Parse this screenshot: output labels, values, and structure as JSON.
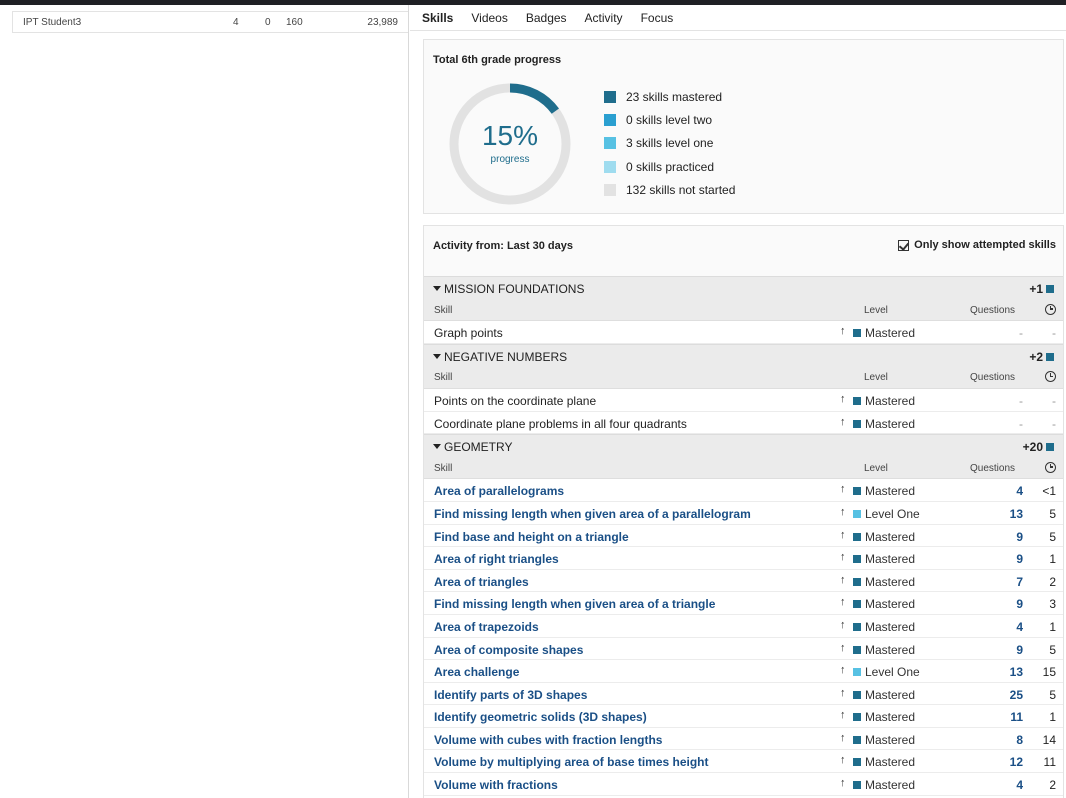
{
  "student": {
    "name": "IPT Student3",
    "col_a": "4",
    "col_b": "0",
    "col_c": "160",
    "col_d": "23,989"
  },
  "tabs": [
    {
      "label": "Skills",
      "active": true
    },
    {
      "label": "Videos",
      "active": false
    },
    {
      "label": "Badges",
      "active": false
    },
    {
      "label": "Activity",
      "active": false
    },
    {
      "label": "Focus",
      "active": false
    }
  ],
  "progress": {
    "title": "Total 6th grade progress",
    "percent_label": "15%",
    "sub_label": "progress",
    "fraction": 0.15,
    "legend": [
      {
        "label": "23 skills mastered",
        "color": "#1f6d8c"
      },
      {
        "label": "0 skills level two",
        "color": "#2b9fd0"
      },
      {
        "label": "3 skills level one",
        "color": "#57c1e3"
      },
      {
        "label": "0 skills practiced",
        "color": "#9fdcef"
      },
      {
        "label": "132 skills not started",
        "color": "#e2e2e2"
      }
    ]
  },
  "activity": {
    "label": "Activity from: Last 30 days",
    "filter_label": "Only show attempted skills"
  },
  "columns": {
    "skill": "Skill",
    "level": "Level",
    "questions": "Questions"
  },
  "colors": {
    "mastered": "#1f6d8c",
    "level_one": "#57c1e3",
    "link": "#1a4f86"
  },
  "sections": [
    {
      "name": "MISSION FOUNDATIONS",
      "count": "+1",
      "skills": [
        {
          "name": "Graph points",
          "level": "Mastered",
          "questions": "-",
          "time": "-",
          "link": false
        }
      ]
    },
    {
      "name": "NEGATIVE NUMBERS",
      "count": "+2",
      "skills": [
        {
          "name": "Points on the coordinate plane",
          "level": "Mastered",
          "questions": "-",
          "time": "-",
          "link": false
        },
        {
          "name": "Coordinate plane problems in all four quadrants",
          "level": "Mastered",
          "questions": "-",
          "time": "-",
          "link": false
        }
      ]
    },
    {
      "name": "GEOMETRY",
      "count": "+20",
      "skills": [
        {
          "name": "Area of parallelograms",
          "level": "Mastered",
          "questions": "4",
          "time": "<1",
          "link": true
        },
        {
          "name": "Find missing length when given area of a parallelogram",
          "level": "Level One",
          "questions": "13",
          "time": "5",
          "link": true
        },
        {
          "name": "Find base and height on a triangle",
          "level": "Mastered",
          "questions": "9",
          "time": "5",
          "link": true
        },
        {
          "name": "Area of right triangles",
          "level": "Mastered",
          "questions": "9",
          "time": "1",
          "link": true
        },
        {
          "name": "Area of triangles",
          "level": "Mastered",
          "questions": "7",
          "time": "2",
          "link": true
        },
        {
          "name": "Find missing length when given area of a triangle",
          "level": "Mastered",
          "questions": "9",
          "time": "3",
          "link": true
        },
        {
          "name": "Area of trapezoids",
          "level": "Mastered",
          "questions": "4",
          "time": "1",
          "link": true
        },
        {
          "name": "Area of composite shapes",
          "level": "Mastered",
          "questions": "9",
          "time": "5",
          "link": true
        },
        {
          "name": "Area challenge",
          "level": "Level One",
          "questions": "13",
          "time": "15",
          "link": true
        },
        {
          "name": "Identify parts of 3D shapes",
          "level": "Mastered",
          "questions": "25",
          "time": "5",
          "link": true
        },
        {
          "name": "Identify geometric solids (3D shapes)",
          "level": "Mastered",
          "questions": "11",
          "time": "1",
          "link": true
        },
        {
          "name": "Volume with cubes with fraction lengths",
          "level": "Mastered",
          "questions": "8",
          "time": "14",
          "link": true
        },
        {
          "name": "Volume by multiplying area of base times height",
          "level": "Mastered",
          "questions": "12",
          "time": "11",
          "link": true
        },
        {
          "name": "Volume with fractions",
          "level": "Mastered",
          "questions": "4",
          "time": "2",
          "link": true
        }
      ]
    }
  ]
}
